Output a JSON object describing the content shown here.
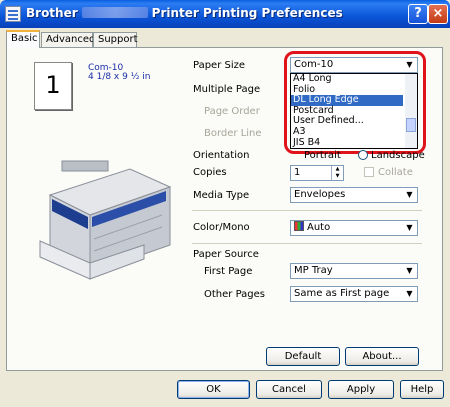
{
  "window": {
    "title_prefix": "Brother",
    "title_suffix": "Printer Printing Preferences",
    "help_label": "?",
    "close_label": "×"
  },
  "tabs": [
    {
      "label": "Basic"
    },
    {
      "label": "Advanced"
    },
    {
      "label": "Support"
    }
  ],
  "preview": {
    "page_number": "1",
    "size_name": "Com-10",
    "size_dimensions": "4 1/8 x 9 ½ in"
  },
  "labels": {
    "paper_size": "Paper Size",
    "multiple_page": "Multiple Page",
    "page_order": "Page Order",
    "border_line": "Border Line",
    "orientation": "Orientation",
    "copies": "Copies",
    "media_type": "Media Type",
    "color_mono": "Color/Mono",
    "paper_source": "Paper Source",
    "first_page": "First Page",
    "other_pages": "Other Pages",
    "portrait": "Portrait",
    "landscape": "Landscape",
    "collate": "Collate"
  },
  "fields": {
    "paper_size_value": "Com-10",
    "copies_value": "1",
    "media_type_value": "Envelopes",
    "color_mono_value": "Auto",
    "first_page_value": "MP Tray",
    "other_pages_value": "Same as First page"
  },
  "paper_size_dropdown": {
    "options": [
      "A4 Long",
      "Folio",
      "DL Long Edge",
      "Postcard",
      "User Defined...",
      "A3",
      "JIS B4"
    ],
    "highlighted": "DL Long Edge"
  },
  "buttons": {
    "default": "Default",
    "about": "About...",
    "ok": "OK",
    "cancel": "Cancel",
    "apply": "Apply",
    "help": "Help"
  },
  "colors": {
    "titlebar": "#0a55d8",
    "highlight": "#316ac5",
    "annotation_ring": "#e0121a"
  }
}
